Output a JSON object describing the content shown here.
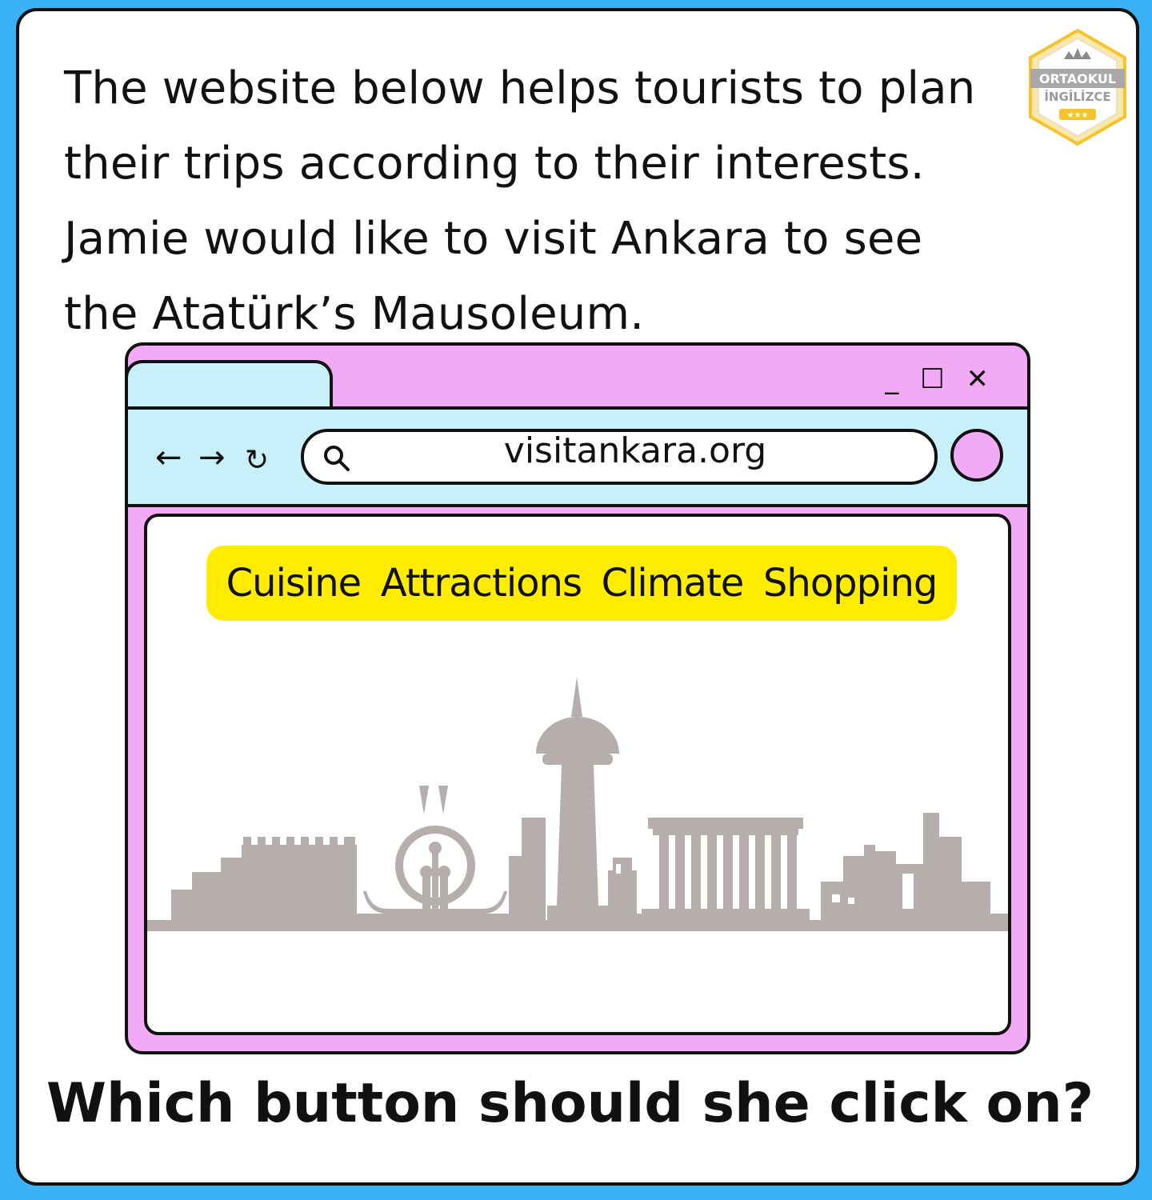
{
  "intro": {
    "lines": [
      "The website below helps tourists to plan",
      "their trips according to their interests.",
      "Jamie would like to visit Ankara to see",
      "the Atatürk’s Mausoleum."
    ]
  },
  "logo": {
    "line1": "ORTAOKUL",
    "line2": "İNGİLİZCE",
    "brand_color": "#f4c430"
  },
  "browser": {
    "url": "visitankara.org",
    "controls": {
      "minimize": "_",
      "maximize": "☐",
      "close": "✕"
    },
    "nav": {
      "back": "←",
      "forward": "→",
      "reload": "↻"
    },
    "menu": [
      "Cuisine",
      "Attractions",
      "Climate",
      "Shopping"
    ],
    "colors": {
      "frame": "#f2a9f6",
      "toolbar": "#c7f0fb",
      "menu": "#ffec00",
      "skyline": "#b5aeac"
    }
  },
  "question": "Which button should she click on?"
}
